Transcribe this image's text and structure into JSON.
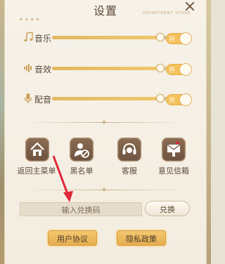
{
  "header": {
    "title": "设置",
    "subtitle": "DEPARTMENT STORE",
    "stars": "✦✦✦✦"
  },
  "audio": {
    "rows": [
      {
        "label": "音乐",
        "icon": "music-note-icon",
        "level": 0.88,
        "toggle": "开"
      },
      {
        "label": "音效",
        "icon": "sound-wave-icon",
        "level": 0.88,
        "toggle": "开"
      },
      {
        "label": "配音",
        "icon": "microphone-icon",
        "level": 0.88,
        "toggle": "开"
      }
    ]
  },
  "quick_actions": [
    {
      "label": "返回主菜单",
      "icon": "home-icon"
    },
    {
      "label": "黑名单",
      "icon": "block-user-icon"
    },
    {
      "label": "客服",
      "icon": "headset-icon"
    },
    {
      "label": "意见信箱",
      "icon": "mailbox-icon"
    }
  ],
  "redeem": {
    "placeholder": "输入兑换码",
    "button_label": "兑换"
  },
  "footer": {
    "user_agreement": "用户协议",
    "privacy_policy": "隐私政策"
  },
  "colors": {
    "accent": "#f0c86a",
    "icon_bg": "#7a5e49",
    "text": "#5a4a3a",
    "arrow": "#e0273a"
  }
}
